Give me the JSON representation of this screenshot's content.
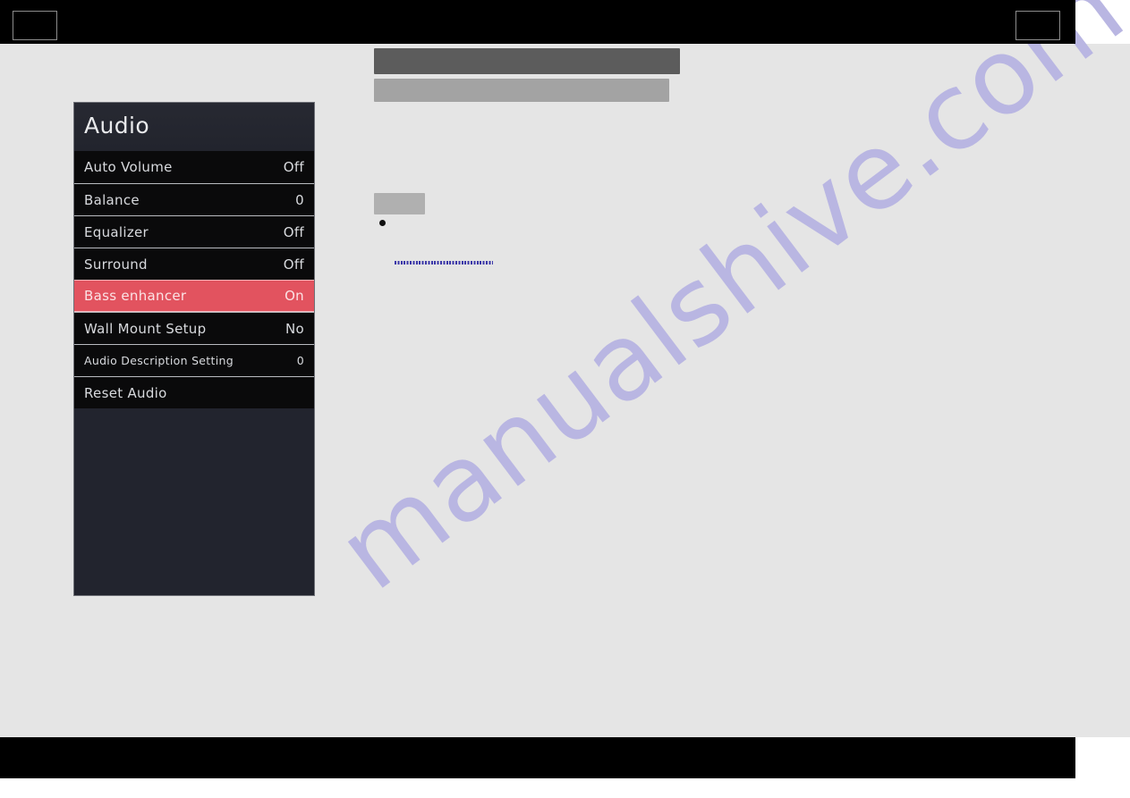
{
  "page": {
    "watermark": "manualshive.com",
    "background_color": "#e5e5e5",
    "header_color": "#000000",
    "footer_color": "#000000"
  },
  "osd": {
    "title": "Audio",
    "accent_color": "#e2535f",
    "panel_color": "#22242e",
    "row_color": "#0a0a0b",
    "rows": [
      {
        "label": "Auto Volume",
        "value": "Off",
        "selected": false,
        "small": false
      },
      {
        "label": "Balance",
        "value": "0",
        "selected": false,
        "small": false
      },
      {
        "label": "Equalizer",
        "value": "Off",
        "selected": false,
        "small": false
      },
      {
        "label": "Surround",
        "value": "Off",
        "selected": false,
        "small": false
      },
      {
        "label": "Bass enhancer",
        "value": "On",
        "selected": true,
        "small": false
      },
      {
        "label": "Wall Mount Setup",
        "value": "No",
        "selected": false,
        "small": false
      },
      {
        "label": "Audio Description Setting",
        "value": "0",
        "selected": false,
        "small": true
      },
      {
        "label": "Reset Audio",
        "value": "",
        "selected": false,
        "small": false
      }
    ]
  },
  "redacted": {
    "title_block": "",
    "subtitle_block": "",
    "small_block": "",
    "link_line": ""
  }
}
